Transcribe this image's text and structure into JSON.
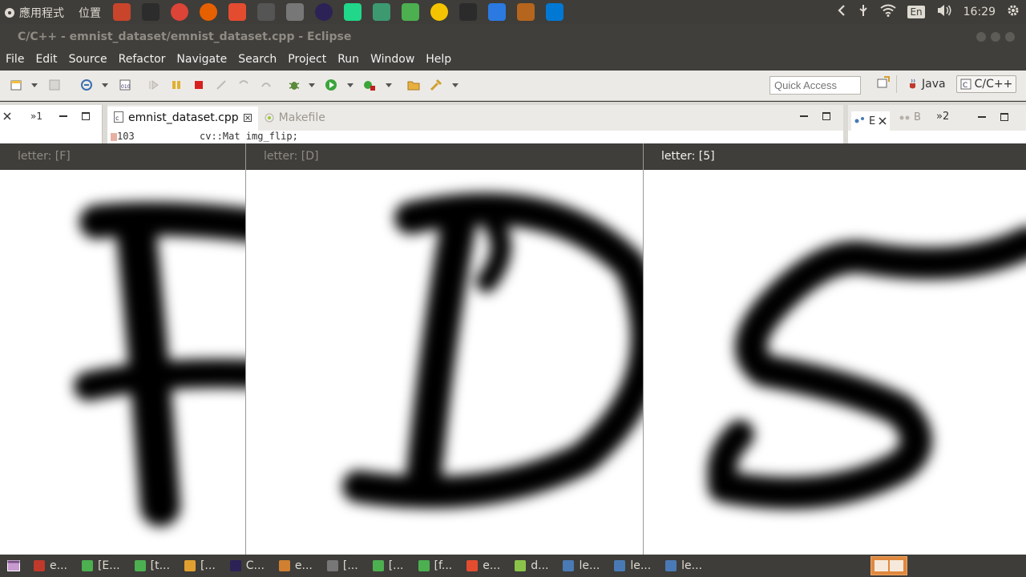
{
  "top_panel": {
    "applications": "應用程式",
    "places": "位置",
    "launchers": [
      {
        "name": "paint-icon",
        "color": "#c8442a"
      },
      {
        "name": "monitor-icon",
        "color": "#2c2c2c"
      },
      {
        "name": "chrome-icon",
        "color": "#db4437"
      },
      {
        "name": "firefox-icon",
        "color": "#e66000"
      },
      {
        "name": "git-icon",
        "color": "#e44c30"
      },
      {
        "name": "tools-icon",
        "color": "#555555"
      },
      {
        "name": "calculator-icon",
        "color": "#777777"
      },
      {
        "name": "eclipse-icon",
        "color": "#2c2255"
      },
      {
        "name": "pycharm-icon",
        "color": "#21d789"
      },
      {
        "name": "image-viewer-icon",
        "color": "#3d9970"
      },
      {
        "name": "terminal-green-icon",
        "color": "#4caf50"
      },
      {
        "name": "e-icon",
        "color": "#f5c400"
      },
      {
        "name": "terminal-icon",
        "color": "#2b2b2b"
      },
      {
        "name": "cloud-icon",
        "color": "#2a7ae2"
      },
      {
        "name": "archive-icon",
        "color": "#b5651d"
      },
      {
        "name": "vscode-icon",
        "color": "#0078d4"
      }
    ],
    "language": "En",
    "time": "16:29"
  },
  "eclipse": {
    "title": "C/C++ - emnist_dataset/emnist_dataset.cpp - Eclipse",
    "menu": [
      "File",
      "Edit",
      "Source",
      "Refactor",
      "Navigate",
      "Search",
      "Project",
      "Run",
      "Window",
      "Help"
    ],
    "quick_access_placeholder": "Quick Access",
    "perspectives": {
      "java": "Java",
      "cpp": "C/C++"
    },
    "left_view": {
      "chevron_label": "»1"
    },
    "editor": {
      "tabs": [
        {
          "label": "emnist_dataset.cpp",
          "active": true
        },
        {
          "label": "Makefile",
          "active": false
        }
      ],
      "line_number": "103",
      "line_code": "cv::Mat img_flip;"
    },
    "right_view": {
      "tab_e": "E",
      "tab_b": "B",
      "chevron_label": "»2"
    }
  },
  "image_windows": [
    {
      "title": "letter: [F]",
      "focused": false
    },
    {
      "title": "letter: [D]",
      "focused": false
    },
    {
      "title": "letter: [5]",
      "focused": true
    }
  ],
  "taskbar": {
    "items": [
      {
        "label": "e...",
        "color": "#c0392b"
      },
      {
        "label": "[E...",
        "color": "#4caf50"
      },
      {
        "label": "[t...",
        "color": "#4caf50"
      },
      {
        "label": "[...",
        "color": "#e0a030"
      },
      {
        "label": "C...",
        "color": "#2c2255"
      },
      {
        "label": "e...",
        "color": "#d08030"
      },
      {
        "label": "[...",
        "color": "#777777"
      },
      {
        "label": "[...",
        "color": "#4caf50"
      },
      {
        "label": "[f...",
        "color": "#4caf50"
      },
      {
        "label": "e...",
        "color": "#e44c30"
      },
      {
        "label": "d...",
        "color": "#8bc34a"
      },
      {
        "label": "le...",
        "color": "#4a7ab5"
      },
      {
        "label": "le...",
        "color": "#4a7ab5"
      },
      {
        "label": "le...",
        "color": "#4a7ab5"
      }
    ]
  }
}
